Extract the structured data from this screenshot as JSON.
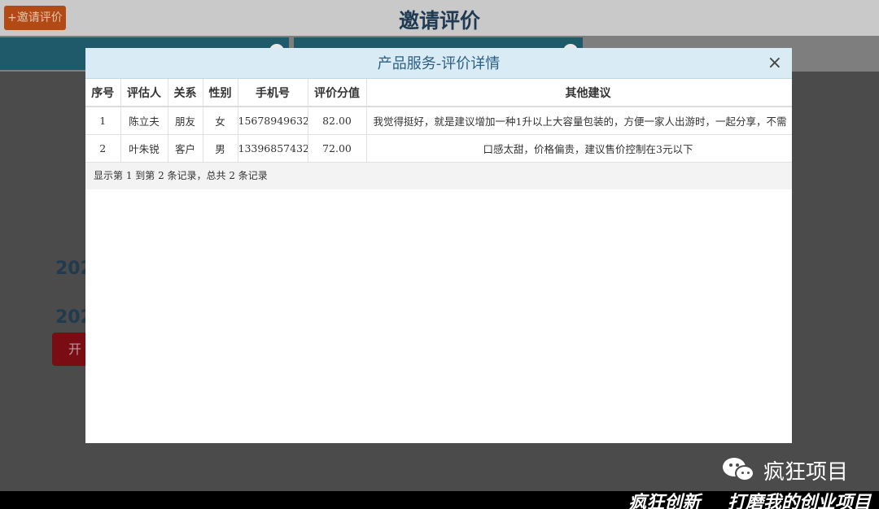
{
  "page": {
    "invite_button": "+邀请评价",
    "title": "邀请评价",
    "year_text_1": "202",
    "year_text_2": "202",
    "start_button": "开"
  },
  "modal": {
    "title": "产品服务-评价详情",
    "close": "×"
  },
  "table": {
    "headers": [
      "序号",
      "评估人",
      "关系",
      "性别",
      "手机号",
      "评价分值",
      "其他建议"
    ],
    "rows": [
      [
        "1",
        "陈立夫",
        "朋友",
        "女",
        "15678949632",
        "82.00",
        "我觉得挺好，就是建议增加一种1升以上大容量包装的，方便一家人出游时，一起分享，不需"
      ],
      [
        "2",
        "叶朱锐",
        "客户",
        "男",
        "13396857432",
        "72.00",
        "口感太甜，价格偏贵，建议售价控制在3元以下"
      ]
    ],
    "footer": "显示第 1 到第 2 条记录，总共 2 条记录"
  },
  "watermark": {
    "icon": "wechat-icon",
    "text": "疯狂项目"
  },
  "banner": {
    "text": "疯狂创新 打磨我的创业项目"
  }
}
